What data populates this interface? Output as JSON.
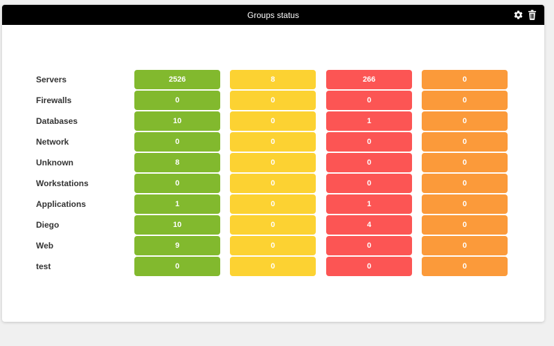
{
  "widget": {
    "title": "Groups status",
    "actions": [
      {
        "name": "settings",
        "icon": "gear-icon"
      },
      {
        "name": "delete",
        "icon": "trash-icon"
      }
    ]
  },
  "colors": {
    "normal": "#82b92e",
    "warning": "#fcd232",
    "critical": "#fc5554",
    "unknown": "#fb9a3a",
    "header_bg": "#000000"
  },
  "groups": [
    {
      "name": "Servers",
      "normal": "2526",
      "warning": "8",
      "critical": "266",
      "unknown": "0"
    },
    {
      "name": "Firewalls",
      "normal": "0",
      "warning": "0",
      "critical": "0",
      "unknown": "0"
    },
    {
      "name": "Databases",
      "normal": "10",
      "warning": "0",
      "critical": "1",
      "unknown": "0"
    },
    {
      "name": "Network",
      "normal": "0",
      "warning": "0",
      "critical": "0",
      "unknown": "0"
    },
    {
      "name": "Unknown",
      "normal": "8",
      "warning": "0",
      "critical": "0",
      "unknown": "0"
    },
    {
      "name": "Workstations",
      "normal": "0",
      "warning": "0",
      "critical": "0",
      "unknown": "0"
    },
    {
      "name": "Applications",
      "normal": "1",
      "warning": "0",
      "critical": "1",
      "unknown": "0"
    },
    {
      "name": "Diego",
      "normal": "10",
      "warning": "0",
      "critical": "4",
      "unknown": "0"
    },
    {
      "name": "Web",
      "normal": "9",
      "warning": "0",
      "critical": "0",
      "unknown": "0"
    },
    {
      "name": "test",
      "normal": "0",
      "warning": "0",
      "critical": "0",
      "unknown": "0"
    }
  ]
}
